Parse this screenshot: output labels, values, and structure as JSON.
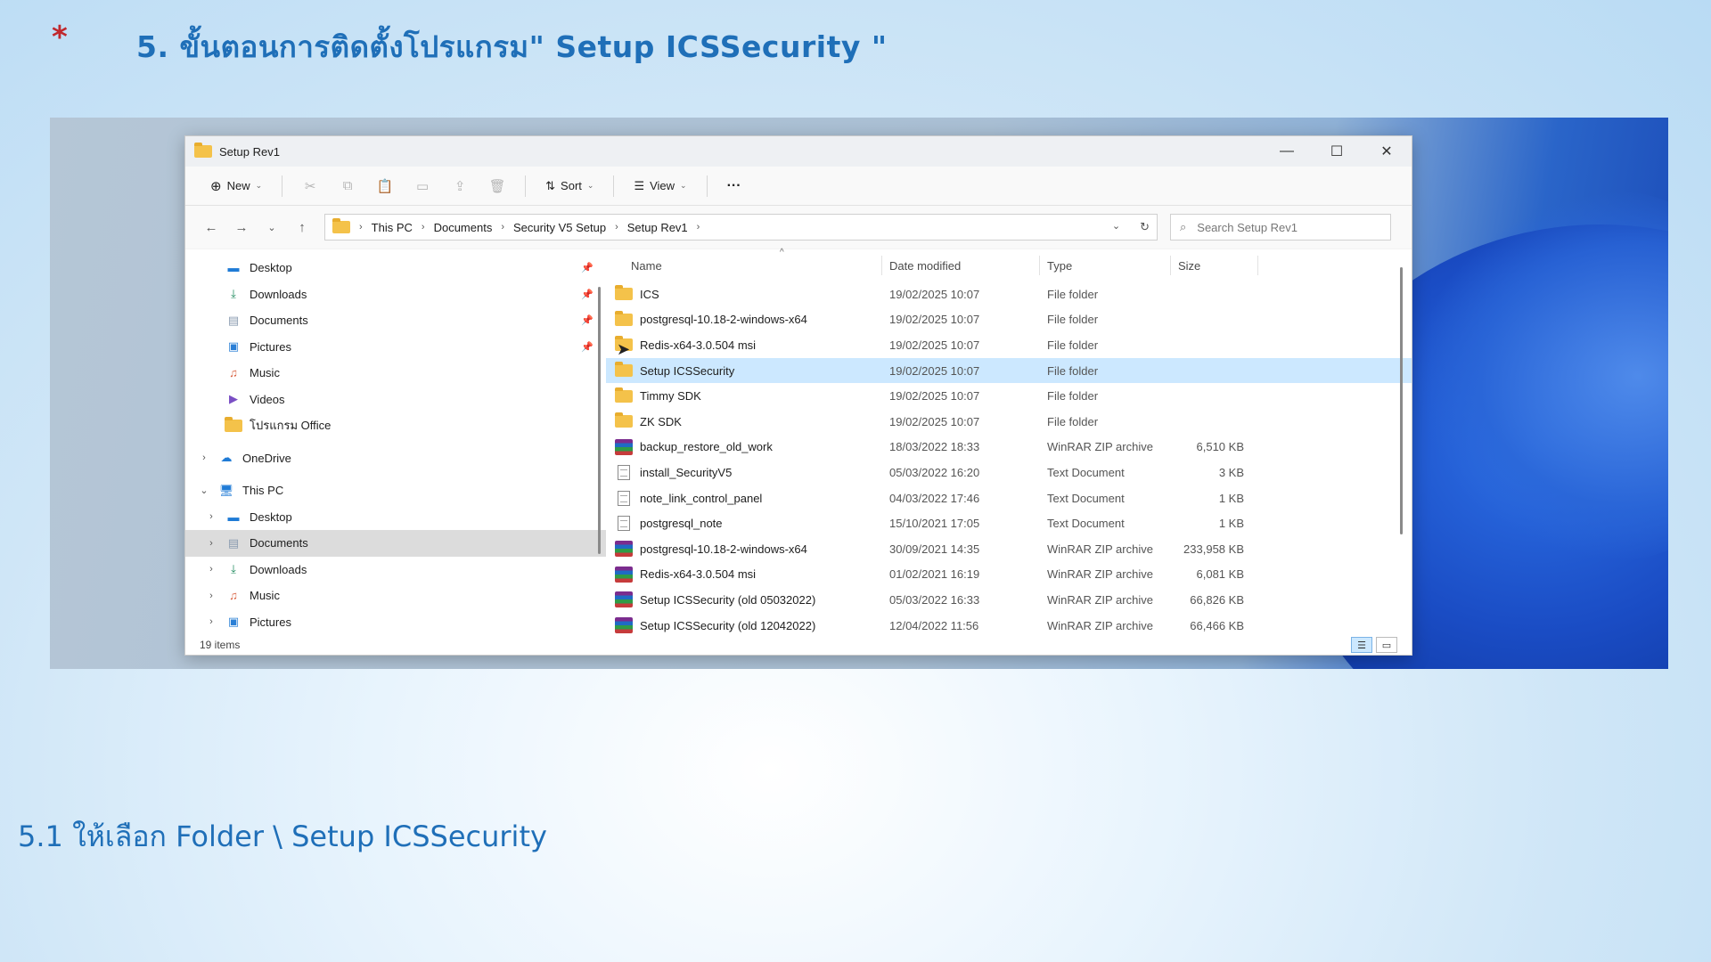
{
  "slide": {
    "bullet": "*",
    "title": "5. ขั้นตอนการติดตั้งโปรแกรม\" Setup ICSSecurity \"",
    "subtitle": "5.1 ให้เลือก Folder \\ Setup ICSSecurity"
  },
  "window": {
    "title": "Setup Rev1",
    "controls": {
      "minimize": "—",
      "maximize": "☐",
      "close": "✕"
    }
  },
  "toolbar": {
    "new_label": "New",
    "sort_label": "Sort",
    "view_label": "View",
    "more_label": "···"
  },
  "address": {
    "crumbs": [
      "This PC",
      "Documents",
      "Security V5 Setup",
      "Setup Rev1"
    ],
    "search_placeholder": "Search Setup Rev1"
  },
  "nav_pane": [
    {
      "label": "Desktop",
      "icon": "desktop-icon",
      "pinned": true
    },
    {
      "label": "Downloads",
      "icon": "download-icon",
      "pinned": true
    },
    {
      "label": "Documents",
      "icon": "documents-icon",
      "pinned": true
    },
    {
      "label": "Pictures",
      "icon": "pictures-icon",
      "pinned": true
    },
    {
      "label": "Music",
      "icon": "music-icon",
      "pinned": false
    },
    {
      "label": "Videos",
      "icon": "videos-icon",
      "pinned": false
    },
    {
      "label": "โปรแกรม Office",
      "icon": "folder-icon",
      "pinned": false
    },
    {
      "label": "OneDrive",
      "icon": "onedrive-icon",
      "pinned": false
    },
    {
      "label": "This PC",
      "icon": "this-pc-icon",
      "pinned": false
    },
    {
      "label": "Desktop",
      "icon": "desktop-icon",
      "pinned": false
    },
    {
      "label": "Documents",
      "icon": "documents-icon",
      "pinned": false
    },
    {
      "label": "Downloads",
      "icon": "download-icon",
      "pinned": false
    },
    {
      "label": "Music",
      "icon": "music-icon",
      "pinned": false
    },
    {
      "label": "Pictures",
      "icon": "pictures-icon",
      "pinned": false
    }
  ],
  "columns": {
    "name": "Name",
    "date": "Date modified",
    "type": "Type",
    "size": "Size"
  },
  "files": [
    {
      "name": "ICS",
      "date": "19/02/2025 10:07",
      "type": "File folder",
      "size": "",
      "kind": "folder"
    },
    {
      "name": "postgresql-10.18-2-windows-x64",
      "date": "19/02/2025 10:07",
      "type": "File folder",
      "size": "",
      "kind": "folder"
    },
    {
      "name": "Redis-x64-3.0.504 msi",
      "date": "19/02/2025 10:07",
      "type": "File folder",
      "size": "",
      "kind": "folder"
    },
    {
      "name": "Setup ICSSecurity",
      "date": "19/02/2025 10:07",
      "type": "File folder",
      "size": "",
      "kind": "folder"
    },
    {
      "name": "Timmy SDK",
      "date": "19/02/2025 10:07",
      "type": "File folder",
      "size": "",
      "kind": "folder"
    },
    {
      "name": "ZK SDK",
      "date": "19/02/2025 10:07",
      "type": "File folder",
      "size": "",
      "kind": "folder"
    },
    {
      "name": "backup_restore_old_work",
      "date": "18/03/2022 18:33",
      "type": "WinRAR ZIP archive",
      "size": "6,510 KB",
      "kind": "zip"
    },
    {
      "name": "install_SecurityV5",
      "date": "05/03/2022 16:20",
      "type": "Text Document",
      "size": "3 KB",
      "kind": "txt"
    },
    {
      "name": "note_link_control_panel",
      "date": "04/03/2022 17:46",
      "type": "Text Document",
      "size": "1 KB",
      "kind": "txt"
    },
    {
      "name": "postgresql_note",
      "date": "15/10/2021 17:05",
      "type": "Text Document",
      "size": "1 KB",
      "kind": "txt"
    },
    {
      "name": "postgresql-10.18-2-windows-x64",
      "date": "30/09/2021 14:35",
      "type": "WinRAR ZIP archive",
      "size": "233,958 KB",
      "kind": "zip"
    },
    {
      "name": "Redis-x64-3.0.504 msi",
      "date": "01/02/2021 16:19",
      "type": "WinRAR ZIP archive",
      "size": "6,081 KB",
      "kind": "zip"
    },
    {
      "name": "Setup ICSSecurity (old 05032022)",
      "date": "05/03/2022 16:33",
      "type": "WinRAR ZIP archive",
      "size": "66,826 KB",
      "kind": "zip"
    },
    {
      "name": "Setup ICSSecurity (old 12042022)",
      "date": "12/04/2022 11:56",
      "type": "WinRAR ZIP archive",
      "size": "66,466 KB",
      "kind": "zip"
    }
  ],
  "status": {
    "items": "19 items"
  },
  "colors": {
    "title": "#1f6fb8",
    "bullet": "#c0282d",
    "selection": "#cce8ff"
  }
}
